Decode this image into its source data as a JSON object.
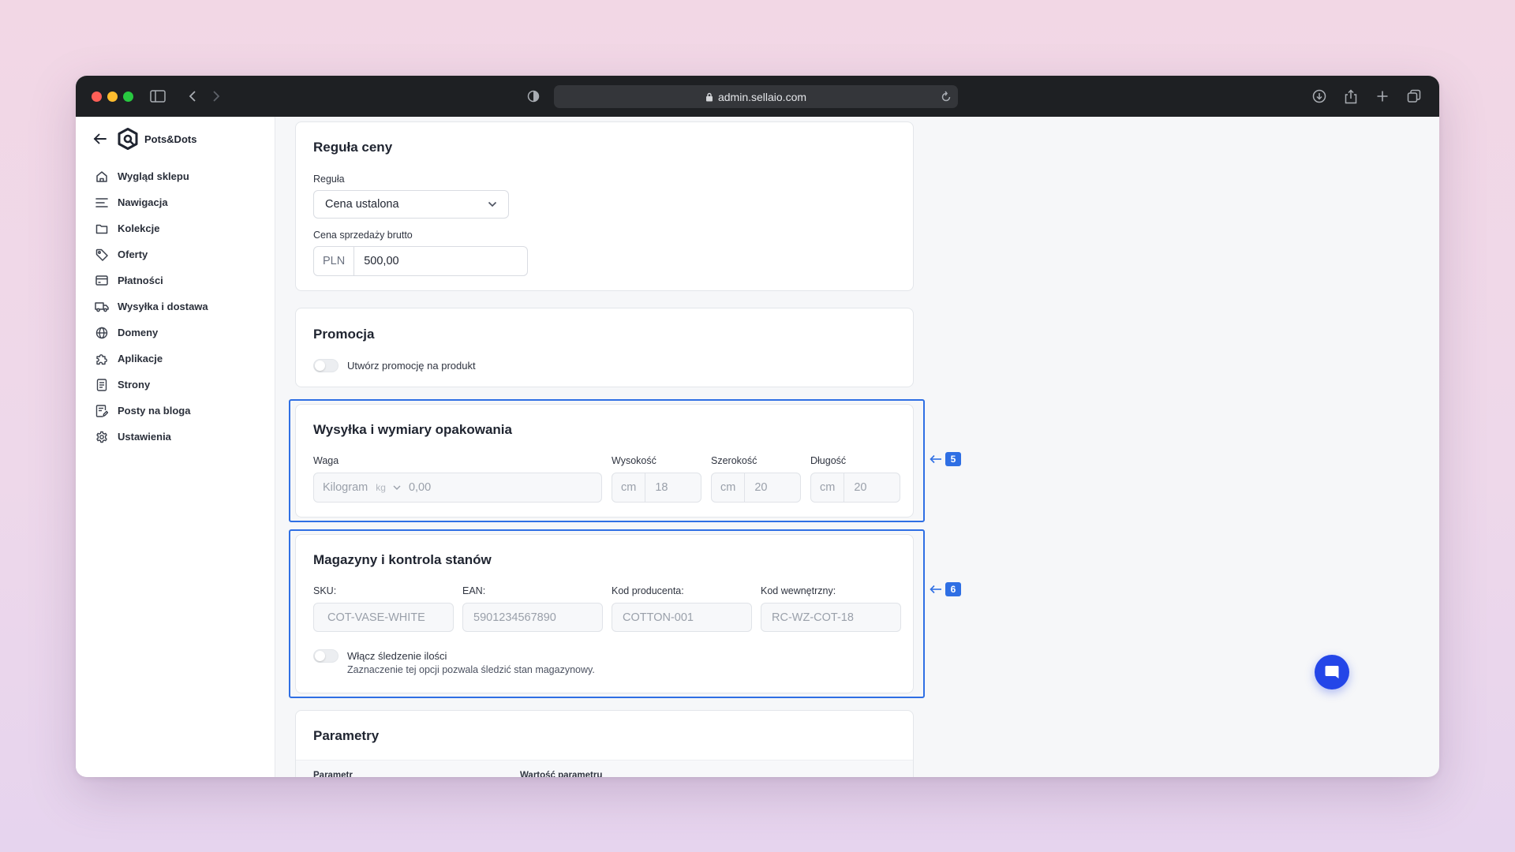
{
  "browser": {
    "url": "admin.sellaio.com"
  },
  "brand": {
    "name": "Pots&Dots"
  },
  "sidebar": {
    "items": [
      {
        "label": "Wygląd sklepu",
        "icon": "home-icon"
      },
      {
        "label": "Nawigacja",
        "icon": "menu-lines-icon"
      },
      {
        "label": "Kolekcje",
        "icon": "folder-icon"
      },
      {
        "label": "Oferty",
        "icon": "tag-icon"
      },
      {
        "label": "Płatności",
        "icon": "credit-card-icon"
      },
      {
        "label": "Wysyłka i dostawa",
        "icon": "truck-icon"
      },
      {
        "label": "Domeny",
        "icon": "globe-icon"
      },
      {
        "label": "Aplikacje",
        "icon": "puzzle-icon"
      },
      {
        "label": "Strony",
        "icon": "page-icon"
      },
      {
        "label": "Posty na bloga",
        "icon": "blog-post-icon"
      },
      {
        "label": "Ustawienia",
        "icon": "gear-icon"
      }
    ]
  },
  "price_rule": {
    "title": "Reguła ceny",
    "rule_label": "Reguła",
    "rule_value": "Cena ustalona",
    "price_label": "Cena sprzedaży brutto",
    "currency": "PLN",
    "price_value": "500,00"
  },
  "promotion": {
    "title": "Promocja",
    "toggle_label": "Utwórz promocję na produkt"
  },
  "shipping": {
    "title": "Wysyłka i wymiary opakowania",
    "weight_label": "Waga",
    "weight_unit": "Kilogram",
    "weight_unit_short": "kg",
    "weight_value": "0,00",
    "height_label": "Wysokość",
    "height_unit": "cm",
    "height_value": "18",
    "width_label": "Szerokość",
    "width_unit": "cm",
    "width_value": "20",
    "length_label": "Długość",
    "length_unit": "cm",
    "length_value": "20",
    "annotation": "5"
  },
  "inventory": {
    "title": "Magazyny i kontrola stanów",
    "sku_label": "SKU:",
    "sku_value": "COT-VASE-WHITE",
    "ean_label": "EAN:",
    "ean_value": "5901234567890",
    "producer_label": "Kod producenta:",
    "producer_value": "COTTON-001",
    "internal_label": "Kod wewnętrzny:",
    "internal_value": "RC-WZ-COT-18",
    "tracking_label": "Włącz śledzenie ilości",
    "tracking_hint": "Zaznaczenie tej opcji pozwala śledzić stan magazynowy.",
    "annotation": "6"
  },
  "parameters": {
    "title": "Parametry",
    "col_param": "Parametr",
    "col_value": "Wartość parametru"
  },
  "colors": {
    "accent": "#2f6fe4",
    "chat": "#2446e8",
    "titlebar": "#1e2023"
  }
}
